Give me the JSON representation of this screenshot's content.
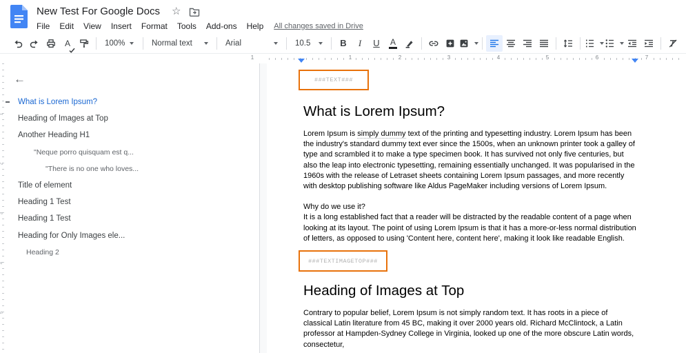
{
  "header": {
    "title": "New Test For Google Docs",
    "menu": [
      "File",
      "Edit",
      "View",
      "Insert",
      "Format",
      "Tools",
      "Add-ons",
      "Help"
    ],
    "saved_status": "All changes saved in Drive",
    "star_glyph": "☆"
  },
  "toolbar": {
    "zoom_value": "100%",
    "styles_value": "Normal text",
    "font_value": "Arial",
    "font_size_value": "10.5",
    "bold_letter": "B",
    "italic_letter": "I",
    "underline_letter": "U",
    "text_color_letter": "A",
    "spellcheck_letter": "A",
    "icons": [
      "undo-icon",
      "redo-icon",
      "print-icon",
      "spellcheck-icon",
      "paint-format-icon",
      "link-icon",
      "add-comment-icon",
      "insert-image-icon",
      "align-left-icon",
      "align-center-icon",
      "align-right-icon",
      "align-justify-icon",
      "line-spacing-icon",
      "numbered-list-icon",
      "bulleted-list-icon",
      "decrease-indent-icon",
      "increase-indent-icon",
      "clear-formatting-icon"
    ],
    "active_tool": "align-left"
  },
  "ruler": {
    "h_marks": [
      "1",
      "1",
      "2",
      "3",
      "4",
      "5",
      "6",
      "7"
    ],
    "v_marks": [
      "1",
      "2",
      "3",
      "4",
      "5"
    ]
  },
  "sidebar": {
    "back_glyph": "←",
    "items": [
      {
        "label": "What is Lorem Ipsum?",
        "level": 0,
        "active": true
      },
      {
        "label": "Heading of Images at Top",
        "level": 0
      },
      {
        "label": "Another Heading H1",
        "level": 0
      },
      {
        "label": "\"Neque porro quisquam est q...",
        "level": 2
      },
      {
        "label": "\"There is no one who loves...",
        "level": 3
      },
      {
        "label": "Title of element",
        "level": 0
      },
      {
        "label": "Heading 1 Test",
        "level": 0
      },
      {
        "label": "Heading 1 Test",
        "level": 0
      },
      {
        "label": "Heading for Only Images ele...",
        "level": 0
      },
      {
        "label": "Heading 2",
        "level": 1
      }
    ]
  },
  "document": {
    "placeholder1": "###TEXT###",
    "heading1": "What is Lorem Ipsum?",
    "para1_pre": "Lorem Ipsum is ",
    "para1_marked": "simply dummy",
    "para1_post": " text of the printing and typesetting industry. Lorem Ipsum has been the industry's standard dummy text ever since the 1500s, when an unknown printer took a galley of type and scrambled it to make a type specimen book. It has survived not only five centuries, but also the leap into electronic typesetting, remaining essentially unchanged. It was popularised in the 1960s with the release of Letraset sheets containing Lorem Ipsum passages, and more recently with desktop publishing software like Aldus PageMaker including versions of Lorem Ipsum.",
    "para2_line1": "Why do we use it?",
    "para2": "It is a long established fact that a reader will be distracted by the readable content of a page when looking at its layout. The point of using Lorem Ipsum is that it has a more-or-less normal distribution of letters, as opposed to using 'Content here, content here', making it look like readable English.",
    "placeholder2": "###TEXTIMAGETOP###",
    "heading2": "Heading of Images at Top",
    "para3": "Contrary to popular belief, Lorem Ipsum is not simply random text. It has roots in a piece of classical Latin literature from 45 BC, making it over 2000 years old. Richard McClintock, a Latin professor at Hampden-Sydney College in Virginia, looked up one of the more obscure Latin words, consectetur,"
  },
  "colors": {
    "accent_blue": "#1a73e8",
    "active_outline_blue": "#1967d2",
    "placeholder_border_orange": "#e8710a",
    "icon_gray": "#3c4043",
    "muted_gray": "#5f6368",
    "ruler_marker_blue": "#4285f4",
    "active_tool_bg": "#e8f0fe"
  }
}
